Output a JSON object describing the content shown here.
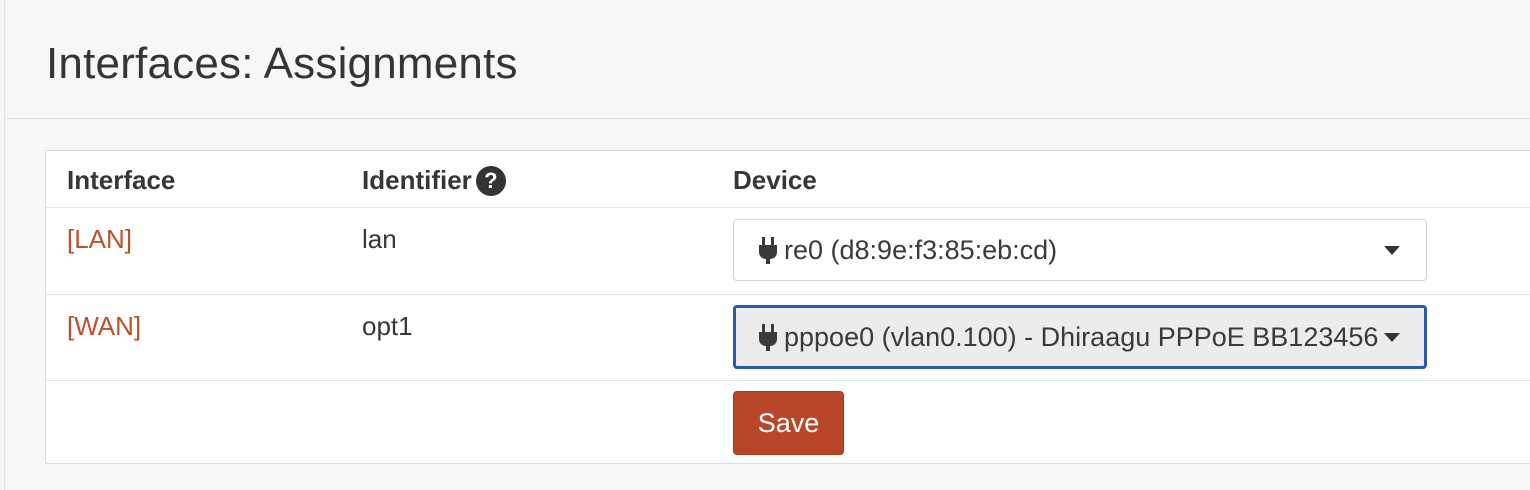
{
  "page": {
    "title": "Interfaces: Assignments"
  },
  "table": {
    "headers": {
      "interface": "Interface",
      "identifier": "Identifier",
      "device": "Device",
      "help_glyph": "?"
    },
    "rows": [
      {
        "interface": "[LAN]",
        "identifier": "lan",
        "device": "re0 (d8:9e:f3:85:eb:cd)",
        "device_icon": "plug-icon",
        "focused": false
      },
      {
        "interface": "[WAN]",
        "identifier": "opt1",
        "device": "pppoe0 (vlan0.100) - Dhiraagu PPPoE BB123456",
        "device_icon": "plug-icon",
        "focused": true
      }
    ],
    "save_label": "Save"
  },
  "colors": {
    "link": "#c1502a",
    "primary_button": "#b8472a",
    "focus_border": "#2b5aa8"
  }
}
